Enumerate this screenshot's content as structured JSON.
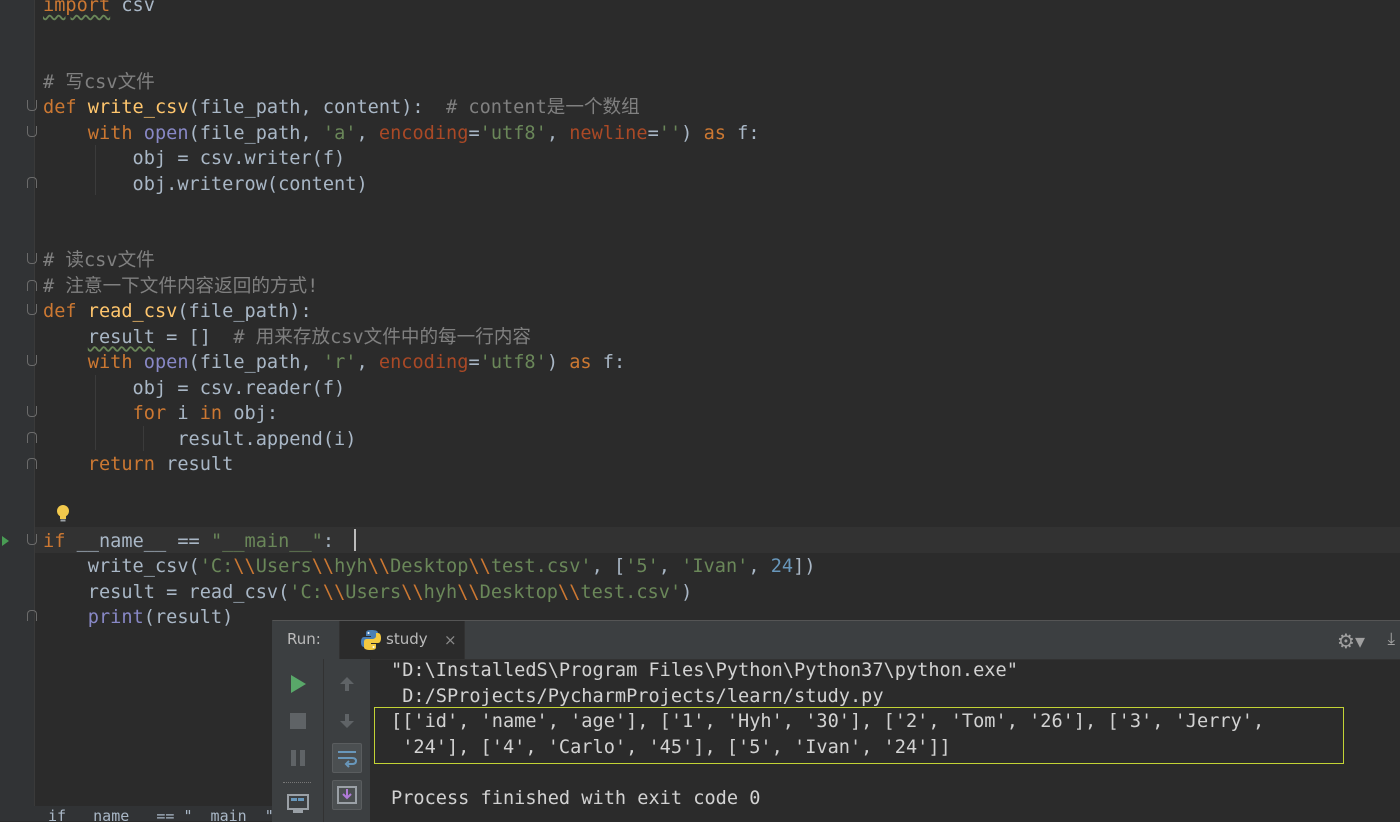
{
  "editor": {
    "lines": [
      {
        "segments": [
          {
            "t": "import",
            "c": "kw wavy"
          },
          {
            "t": " csv",
            "c": ""
          }
        ]
      },
      {
        "segments": []
      },
      {
        "segments": []
      },
      {
        "segments": [
          {
            "t": "# 写csv文件",
            "c": "cm"
          }
        ]
      },
      {
        "segments": [
          {
            "t": "def ",
            "c": "kw"
          },
          {
            "t": "write_csv",
            "c": "fn"
          },
          {
            "t": "(file_path, content):  ",
            "c": ""
          },
          {
            "t": "# content是一个数组",
            "c": "cm"
          }
        ]
      },
      {
        "segments": [
          {
            "t": "    ",
            "c": ""
          },
          {
            "t": "with ",
            "c": "kw"
          },
          {
            "t": "open",
            "c": "bi"
          },
          {
            "t": "(file_path, ",
            "c": ""
          },
          {
            "t": "'a'",
            "c": "str"
          },
          {
            "t": ", ",
            "c": ""
          },
          {
            "t": "encoding",
            "c": "kwarg"
          },
          {
            "t": "=",
            "c": ""
          },
          {
            "t": "'utf8'",
            "c": "str"
          },
          {
            "t": ", ",
            "c": ""
          },
          {
            "t": "newline",
            "c": "kwarg"
          },
          {
            "t": "=",
            "c": ""
          },
          {
            "t": "''",
            "c": "str"
          },
          {
            "t": ") ",
            "c": ""
          },
          {
            "t": "as ",
            "c": "kw"
          },
          {
            "t": "f:",
            "c": ""
          }
        ]
      },
      {
        "segments": [
          {
            "t": "        obj = csv.writer(f)",
            "c": ""
          }
        ]
      },
      {
        "segments": [
          {
            "t": "        obj.writerow(content)",
            "c": ""
          }
        ]
      },
      {
        "segments": []
      },
      {
        "segments": []
      },
      {
        "segments": [
          {
            "t": "# 读csv文件",
            "c": "cm"
          }
        ]
      },
      {
        "segments": [
          {
            "t": "# 注意一下文件内容返回的方式!",
            "c": "cm"
          }
        ]
      },
      {
        "segments": [
          {
            "t": "def ",
            "c": "kw"
          },
          {
            "t": "read_csv",
            "c": "fn"
          },
          {
            "t": "(file_path):",
            "c": ""
          }
        ]
      },
      {
        "segments": [
          {
            "t": "    ",
            "c": ""
          },
          {
            "t": "result",
            "c": "wavy"
          },
          {
            "t": " = []  ",
            "c": ""
          },
          {
            "t": "# 用来存放csv文件中的每一行内容",
            "c": "cm"
          }
        ]
      },
      {
        "segments": [
          {
            "t": "    ",
            "c": ""
          },
          {
            "t": "with ",
            "c": "kw"
          },
          {
            "t": "open",
            "c": "bi"
          },
          {
            "t": "(file_path, ",
            "c": ""
          },
          {
            "t": "'r'",
            "c": "str"
          },
          {
            "t": ", ",
            "c": ""
          },
          {
            "t": "encoding",
            "c": "kwarg"
          },
          {
            "t": "=",
            "c": ""
          },
          {
            "t": "'utf8'",
            "c": "str"
          },
          {
            "t": ") ",
            "c": ""
          },
          {
            "t": "as ",
            "c": "kw"
          },
          {
            "t": "f:",
            "c": ""
          }
        ]
      },
      {
        "segments": [
          {
            "t": "        obj = csv.reader(f)",
            "c": ""
          }
        ]
      },
      {
        "segments": [
          {
            "t": "        ",
            "c": ""
          },
          {
            "t": "for ",
            "c": "kw"
          },
          {
            "t": "i ",
            "c": ""
          },
          {
            "t": "in ",
            "c": "kw"
          },
          {
            "t": "obj:",
            "c": ""
          }
        ]
      },
      {
        "segments": [
          {
            "t": "            result.append(i)",
            "c": ""
          }
        ]
      },
      {
        "segments": [
          {
            "t": "    ",
            "c": ""
          },
          {
            "t": "return ",
            "c": "kw"
          },
          {
            "t": "result",
            "c": ""
          }
        ]
      },
      {
        "segments": []
      },
      {
        "segments": []
      },
      {
        "segments": [
          {
            "t": "if ",
            "c": "kw"
          },
          {
            "t": "__name__ == ",
            "c": ""
          },
          {
            "t": "\"__main__\"",
            "c": "str"
          },
          {
            "t": ":",
            "c": ""
          }
        ]
      },
      {
        "segments": [
          {
            "t": "    write_csv(",
            "c": ""
          },
          {
            "t": "'C:",
            "c": "str"
          },
          {
            "t": "\\\\",
            "c": "esc"
          },
          {
            "t": "Users",
            "c": "str"
          },
          {
            "t": "\\\\",
            "c": "esc"
          },
          {
            "t": "hyh",
            "c": "str"
          },
          {
            "t": "\\\\",
            "c": "esc"
          },
          {
            "t": "Desktop",
            "c": "str"
          },
          {
            "t": "\\\\",
            "c": "esc"
          },
          {
            "t": "test.csv'",
            "c": "str"
          },
          {
            "t": ", [",
            "c": ""
          },
          {
            "t": "'5'",
            "c": "str"
          },
          {
            "t": ", ",
            "c": ""
          },
          {
            "t": "'Ivan'",
            "c": "str"
          },
          {
            "t": ", ",
            "c": ""
          },
          {
            "t": "24",
            "c": "num"
          },
          {
            "t": "])",
            "c": ""
          }
        ]
      },
      {
        "segments": [
          {
            "t": "    result = read_csv(",
            "c": ""
          },
          {
            "t": "'C:",
            "c": "str"
          },
          {
            "t": "\\\\",
            "c": "esc"
          },
          {
            "t": "Users",
            "c": "str"
          },
          {
            "t": "\\\\",
            "c": "esc"
          },
          {
            "t": "hyh",
            "c": "str"
          },
          {
            "t": "\\\\",
            "c": "esc"
          },
          {
            "t": "Desktop",
            "c": "str"
          },
          {
            "t": "\\\\",
            "c": "esc"
          },
          {
            "t": "test.csv'",
            "c": "str"
          },
          {
            "t": ")",
            "c": ""
          }
        ]
      },
      {
        "segments": [
          {
            "t": "    ",
            "c": ""
          },
          {
            "t": "print",
            "c": "bi"
          },
          {
            "t": "(result)",
            "c": ""
          }
        ]
      }
    ]
  },
  "run": {
    "label": "Run:",
    "tab": "study",
    "tab_close": "×",
    "gear": "⚙▾",
    "pin": "⤓",
    "output": [
      {
        "text": "\"D:\\InstalledS\\Program Files\\Python\\Python37\\python.exe\"",
        "c": "out-path"
      },
      {
        "text": " D:/SProjects/PycharmProjects/learn/study.py",
        "c": "out-path"
      },
      {
        "text": "[['id', 'name', 'age'], ['1', 'Hyh', '30'], ['2', 'Tom', '26'], ['3', 'Jerry',",
        "c": "out-result"
      },
      {
        "text": " '24'], ['4', 'Carlo', '45'], ['5', 'Ivan', '24']]",
        "c": "out-result"
      },
      {
        "text": "",
        "c": "out-result"
      },
      {
        "text": "Process finished with exit code 0",
        "c": "out-result"
      }
    ]
  },
  "breadcrumb": "if __name__ == \"__main__\""
}
